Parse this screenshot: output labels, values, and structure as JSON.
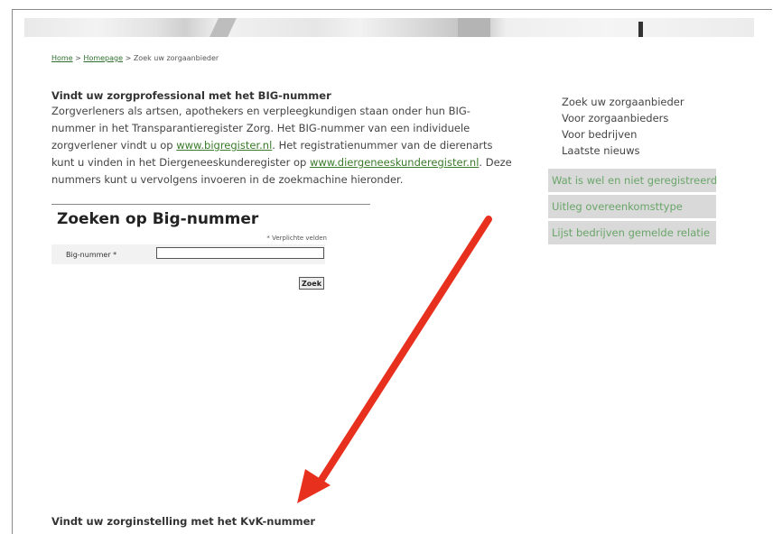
{
  "breadcrumb": {
    "home": "Home",
    "sep1": " > ",
    "homepage": "Homepage",
    "sep2": " > ",
    "current": "Zoek uw zorgaanbieder"
  },
  "intro": {
    "heading": "Vindt uw zorgprofessional met het BIG-nummer",
    "text1": "Zorgverleners als artsen, apothekers en verpleegkundigen staan onder hun BIG-nummer in het Transparantieregister Zorg. Het BIG-nummer van een individuele zorgverlener vindt u op ",
    "link1": "www.bigregister.nl",
    "text2": ". Het registratienummer van de dierenarts kunt u vinden in het Diergeneeskunderegister op ",
    "link2": "www.diergeneeskunderegister.nl",
    "text3": ". Deze nummers kunt u vervolgens invoeren in de zoekmachine hieronder."
  },
  "search": {
    "title": "Zoeken op Big-nummer",
    "required_note": "* Verplichte velden",
    "field_label": "Big-nummer *",
    "field_value": "",
    "button_label": "Zoek"
  },
  "sidebar": {
    "links": [
      "Zoek uw zorgaanbieder",
      "Voor zorgaanbieders",
      "Voor bedrijven",
      "Laatste nieuws"
    ],
    "tabs": [
      "Wat is wel en niet geregistreerd",
      "Uitleg overeenkomsttype",
      "Lijst bedrijven gemelde relatie"
    ]
  },
  "bottom": {
    "heading": "Vindt uw zorginstelling met het KvK-nummer"
  },
  "colors": {
    "link_green": "#3a7a2a",
    "tab_text": "#6aa56a",
    "tab_bg": "#d9d9d9",
    "arrow": "#e8301e"
  }
}
